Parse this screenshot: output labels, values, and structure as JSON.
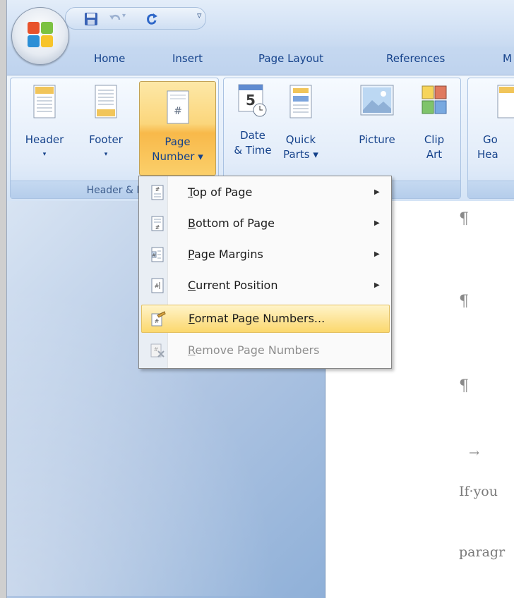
{
  "tabs": [
    "Home",
    "Insert",
    "Page Layout",
    "References",
    "M"
  ],
  "ribbon": {
    "group_label": "Header & F",
    "buttons": {
      "header": {
        "line1": "Header",
        "line2": "▾"
      },
      "footer": {
        "line1": "Footer",
        "line2": "▾"
      },
      "page_number": {
        "line1": "Page",
        "line2": "Number ▾"
      },
      "date_time": {
        "line1": "Date",
        "line2": "& Time"
      },
      "quick_parts": {
        "line1": "Quick",
        "line2": "Parts ▾"
      },
      "picture": {
        "line1": "Picture"
      },
      "clip_art": {
        "line1": "Clip",
        "line2": "Art"
      },
      "go_header": {
        "line1": "Go",
        "line2": "Hea"
      }
    }
  },
  "menu": {
    "items": [
      {
        "first": "T",
        "rest": "op of Page",
        "submenu": "▶"
      },
      {
        "first": "B",
        "rest": "ottom of Page",
        "submenu": "▶"
      },
      {
        "first": "P",
        "rest": "age Margins",
        "submenu": "▶"
      },
      {
        "first": "C",
        "rest": "urrent Position",
        "submenu": "▶"
      },
      {
        "first": "F",
        "rest": "ormat Page Numbers..."
      },
      {
        "first": "R",
        "rest": "emove Page Numbers"
      }
    ]
  },
  "document": {
    "pilcrow": "¶",
    "tab_arrow": "→",
    "line1": "If·you",
    "line2": "paragr"
  },
  "colors": {
    "accent": "#fbd67c",
    "ribbon_text": "#15428b"
  }
}
